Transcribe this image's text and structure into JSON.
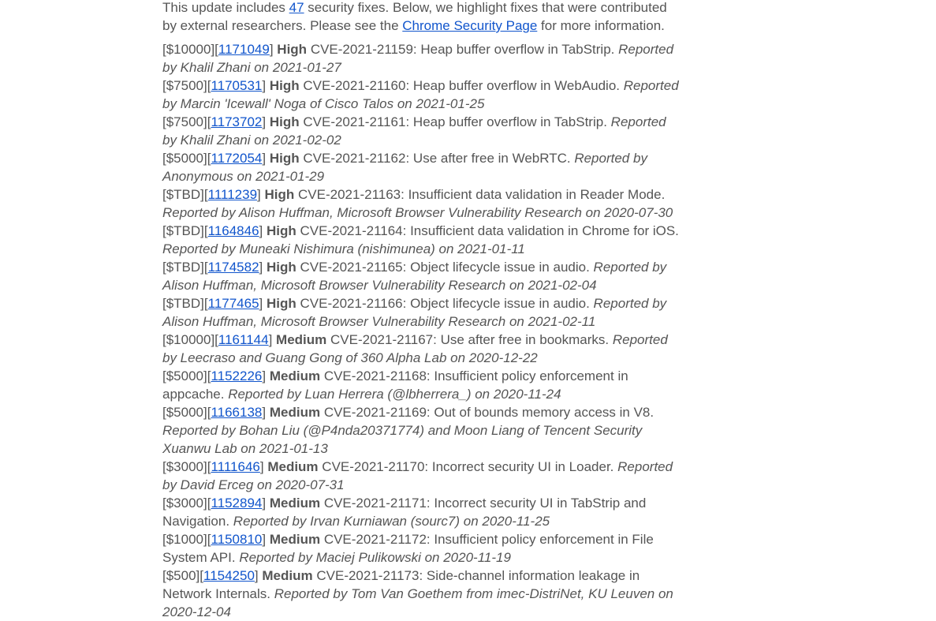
{
  "intro": {
    "prefix": "This update includes ",
    "fix_count": "47",
    "middle": " security fixes. Below, we highlight fixes that were contributed by external researchers. Please see the ",
    "link_text": "Chrome Security Page",
    "suffix": " for more information."
  },
  "entries": [
    {
      "bounty": "[$10000][",
      "bug": "1171049",
      "close": "]",
      "severity": "High",
      "description": "CVE-2021-21159: Heap buffer overflow in TabStrip.",
      "reporter": "Reported by Khalil Zhani on 2021-01-27"
    },
    {
      "bounty": "[$7500][",
      "bug": "1170531",
      "close": "]",
      "severity": "High",
      "description": "CVE-2021-21160: Heap buffer overflow in WebAudio.",
      "reporter": "Reported by Marcin 'Icewall' Noga of Cisco Talos on 2021-01-25"
    },
    {
      "bounty": "[$7500][",
      "bug": "1173702",
      "close": "]",
      "severity": "High",
      "description": "CVE-2021-21161: Heap buffer overflow in TabStrip.",
      "reporter": "Reported by Khalil Zhani on 2021-02-02"
    },
    {
      "bounty": "[$5000][",
      "bug": "1172054",
      "close": "]",
      "severity": "High",
      "description": "CVE-2021-21162: Use after free in WebRTC.",
      "reporter": "Reported by Anonymous on 2021-01-29"
    },
    {
      "bounty": "[$TBD][",
      "bug": "1111239",
      "close": "]",
      "severity": "High",
      "description": "CVE-2021-21163: Insufficient data validation in Reader Mode.",
      "reporter": "Reported by Alison Huffman, Microsoft Browser Vulnerability Research on 2020-07-30"
    },
    {
      "bounty": "[$TBD][",
      "bug": "1164846",
      "close": "]",
      "severity": "High",
      "description": "CVE-2021-21164: Insufficient data validation in Chrome for iOS.",
      "reporter": "Reported by Muneaki Nishimura (nishimunea) on 2021-01-11"
    },
    {
      "bounty": "[$TBD][",
      "bug": "1174582",
      "close": "]",
      "severity": "High",
      "description": "CVE-2021-21165: Object lifecycle issue in audio.",
      "reporter": "Reported by Alison Huffman, Microsoft Browser Vulnerability Research on 2021-02-04"
    },
    {
      "bounty": "[$TBD][",
      "bug": "1177465",
      "close": "]",
      "severity": "High",
      "description": "CVE-2021-21166: Object lifecycle issue in audio.",
      "reporter": "Reported by Alison Huffman, Microsoft Browser Vulnerability Research on 2021-02-11"
    },
    {
      "bounty": "[$10000][",
      "bug": "1161144",
      "close": "]",
      "severity": "Medium",
      "description": "CVE-2021-21167: Use after free in bookmarks.",
      "reporter": "Reported by Leecraso and Guang Gong of 360 Alpha Lab on 2020-12-22"
    },
    {
      "bounty": "[$5000][",
      "bug": "1152226",
      "close": "]",
      "severity": "Medium",
      "description": "CVE-2021-21168: Insufficient policy enforcement in appcache.",
      "reporter": "Reported by Luan Herrera (@lbherrera_) on 2020-11-24"
    },
    {
      "bounty": "[$5000][",
      "bug": "1166138",
      "close": "]",
      "severity": "Medium",
      "description": "CVE-2021-21169: Out of bounds memory access in V8.",
      "reporter": "Reported by Bohan Liu (@P4nda20371774) and Moon Liang of Tencent Security Xuanwu Lab on 2021-01-13"
    },
    {
      "bounty": "[$3000][",
      "bug": "1111646",
      "close": "]",
      "severity": "Medium",
      "description": "CVE-2021-21170: Incorrect security UI in Loader.",
      "reporter": "Reported by David Erceg on 2020-07-31"
    },
    {
      "bounty": "[$3000][",
      "bug": "1152894",
      "close": "]",
      "severity": "Medium",
      "description": "CVE-2021-21171: Incorrect security UI in TabStrip and Navigation.",
      "reporter": "Reported by Irvan Kurniawan (sourc7) on 2020-11-25"
    },
    {
      "bounty": "[$1000][",
      "bug": "1150810",
      "close": "]",
      "severity": "Medium",
      "description": "CVE-2021-21172: Insufficient policy enforcement in File System API.",
      "reporter": "Reported by Maciej Pulikowski on 2020-11-19"
    },
    {
      "bounty": "[$500][",
      "bug": "1154250",
      "close": "]",
      "severity": "Medium",
      "description": "CVE-2021-21173: Side-channel information leakage in Network Internals.",
      "reporter": "Reported by Tom Van Goethem from imec-DistriNet, KU Leuven on 2020-12-04"
    }
  ]
}
